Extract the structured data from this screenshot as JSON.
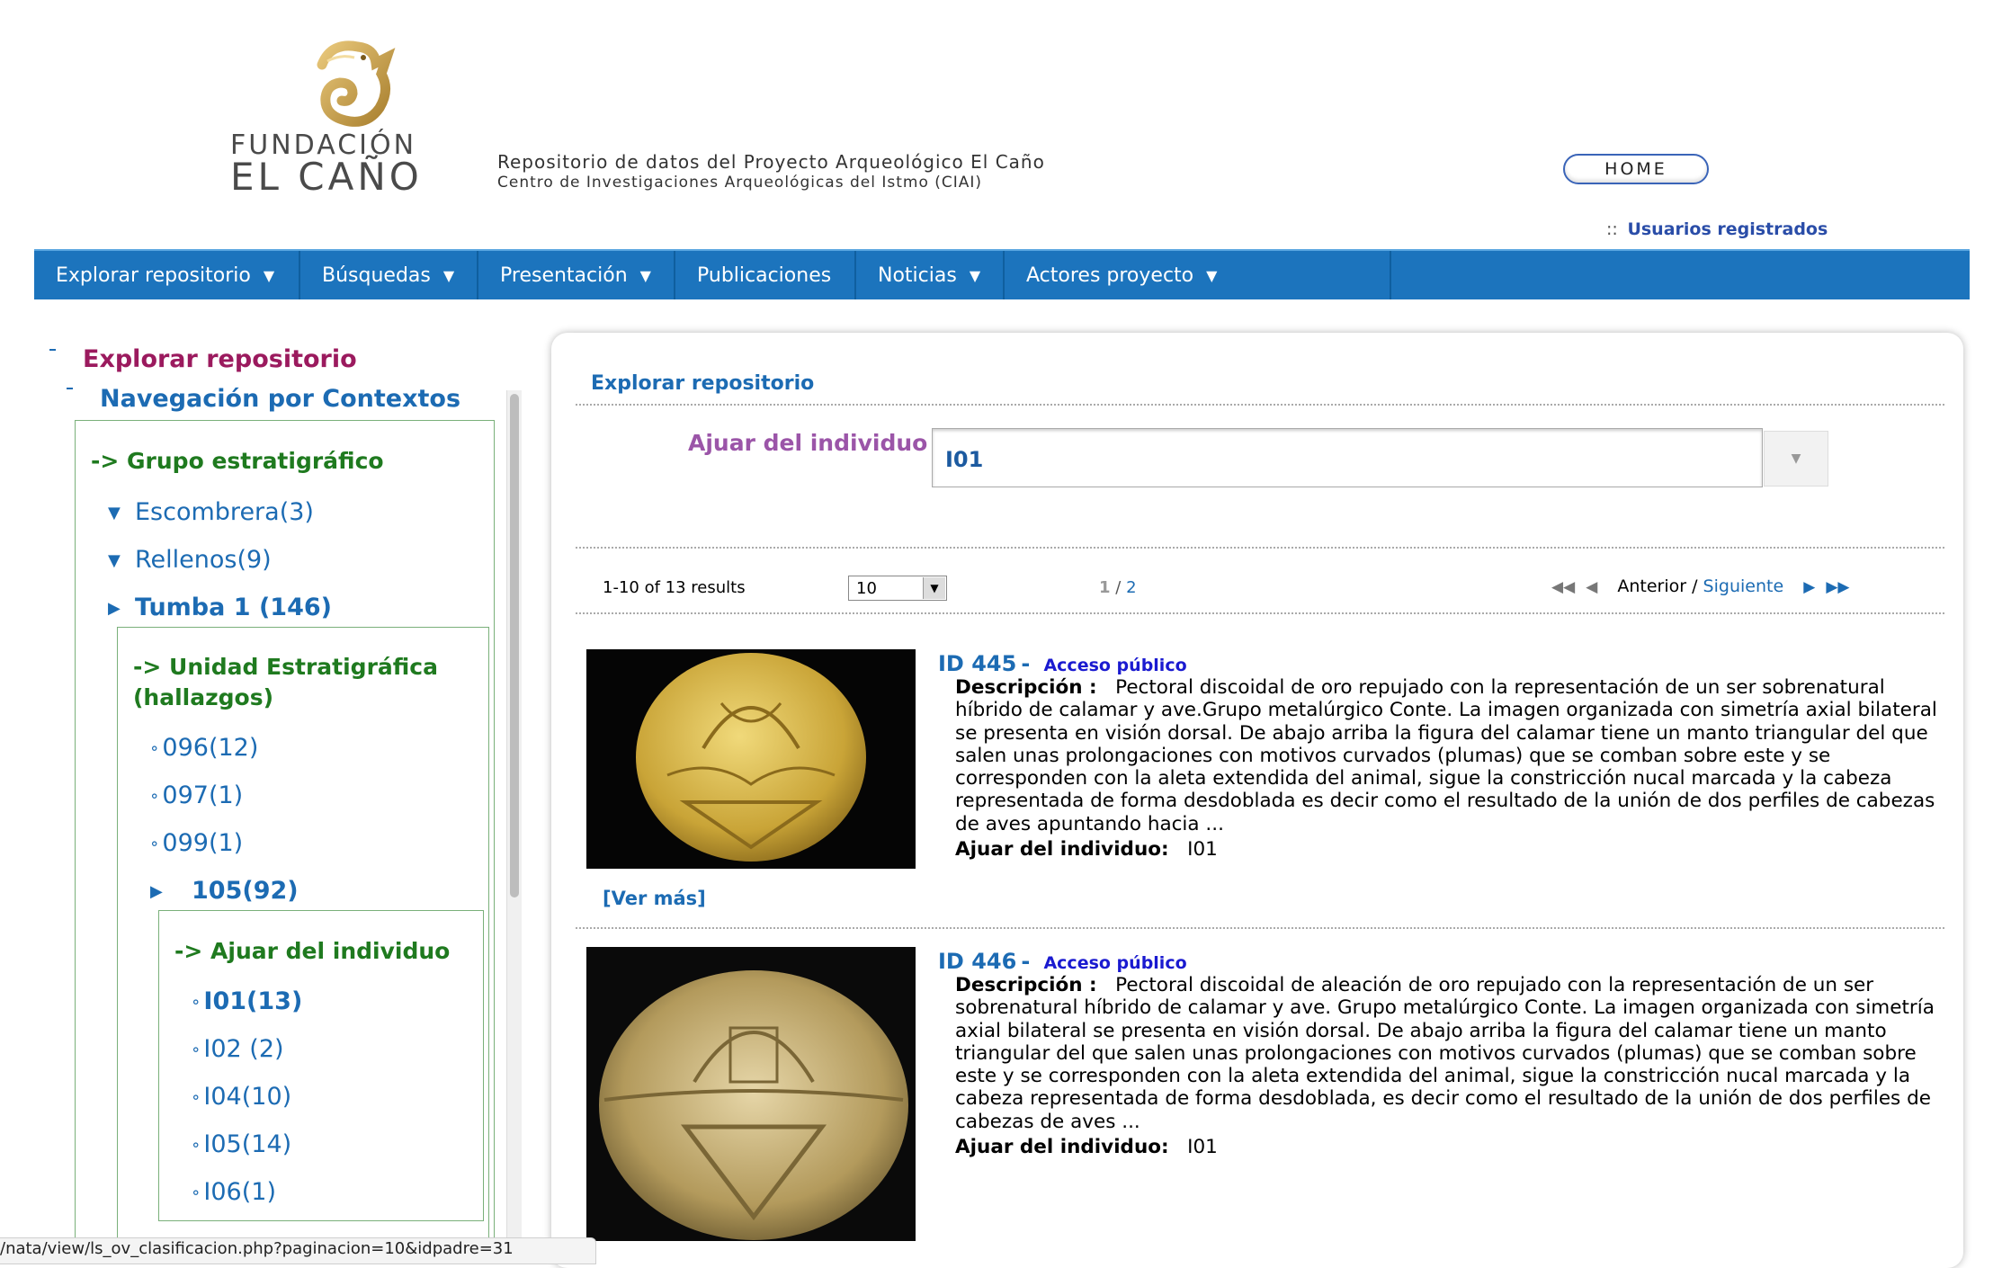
{
  "header": {
    "logo_line1": "FUNDACIÓN",
    "logo_line2": "EL CAÑO",
    "tagline1": "Repositorio de datos del Proyecto Arqueológico El Caño",
    "tagline2": "Centro de Investigaciones Arqueológicas del Istmo (CIAI)",
    "home_label": "HOME",
    "user_sep": "::",
    "user_link": "Usuarios registrados"
  },
  "nav": [
    {
      "label": "Explorar repositorio",
      "dropdown": true
    },
    {
      "label": "Búsquedas",
      "dropdown": true
    },
    {
      "label": "Presentación",
      "dropdown": true
    },
    {
      "label": "Publicaciones",
      "dropdown": false
    },
    {
      "label": "Noticias",
      "dropdown": true
    },
    {
      "label": "Actores proyecto",
      "dropdown": true
    }
  ],
  "sidebar": {
    "title": "Explorar repositorio",
    "subtitle": "Navegación por Contextos",
    "group1": "-> Grupo estratigráfico",
    "items1": [
      "Escombrera(3)",
      "Rellenos(9)",
      "Tumba 1 (146)"
    ],
    "group2_line1": "-> Unidad Estratigráfica",
    "group2_line2": "(hallazgos)",
    "items2": [
      "096(12)",
      "097(1)",
      "099(1)",
      "105(92)"
    ],
    "group3": "-> Ajuar del individuo",
    "items3": [
      "I01(13)",
      "I02 (2)",
      "I04(10)",
      "I05(14)",
      "I06(1)"
    ]
  },
  "main": {
    "title": "Explorar repositorio",
    "filter_label": "Ajuar del individuo",
    "filter_value": "I01",
    "results_count": "1-10 of 13 results",
    "per_page": "10",
    "page_current": "1",
    "page_sep": "/",
    "page_total": "2",
    "prev_label": "Anterior",
    "pager_sep": "/",
    "next_label": "Siguiente",
    "desc_label": "Descripción :",
    "ajuar_label": "Ajuar del individuo:",
    "ver_mas": "[Ver más]"
  },
  "items": [
    {
      "id": "ID  445",
      "dash": "-",
      "access": "Acceso público",
      "desc": "Pectoral discoidal de oro repujado con la representación de un ser sobrenatural híbrido de calamar y ave.Grupo metalúrgico Conte. La imagen organizada con simetría axial bilateral se presenta en visión dorsal. De abajo arriba la figura del calamar tiene un manto triangular del que salen unas prolongaciones con motivos curvados (plumas) que se comban sobre este y se corresponden con la aleta extendida del animal, sigue la constricción nucal marcada y la cabeza representada de forma desdoblada es decir como el resultado de la unión de dos perfiles de cabezas de aves apuntando hacia ...",
      "ajuar": "I01"
    },
    {
      "id": "ID  446",
      "dash": "-",
      "access": "Acceso público",
      "desc": "Pectoral discoidal de aleación de oro repujado con la representación de un ser sobrenatural híbrido de calamar y ave. Grupo metalúrgico Conte. La imagen organizada con simetría axial bilateral se presenta en visión dorsal. De abajo arriba la figura del calamar tiene un manto triangular del que salen unas prolongaciones con motivos curvados (plumas) que se comban sobre este y se corresponden con la aleta extendida del animal, sigue la constricción nucal marcada y la cabeza representada de forma desdoblada, es decir como el resultado de la unión de dos perfiles de cabezas de aves ...",
      "ajuar": "I01"
    }
  ],
  "statusbar": "/nata/view/ls_ov_clasificacion.php?paginacion=10&idpadre=31",
  "colors": {
    "nav_bg": "#1c74bd",
    "link_blue": "#1c6bb3",
    "title_magenta": "#9b1a5e",
    "group_green": "#1f7a1f",
    "filter_purple": "#9b55a8",
    "gold": "#c9a24a"
  }
}
